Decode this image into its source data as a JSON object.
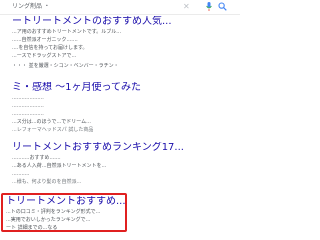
{
  "search": {
    "query": "リング剤品 ・"
  },
  "results": [
    {
      "title": "ートリートメントのおすすめ人気...",
      "snippets": [
        "...ア用のおすすめトリートメントです。ルブル...",
        "......自然派オーガニック.......",
        "....を自信を持ってお届けします。"
      ],
      "sitelinks": "...ースでドラッグストアで...",
      "meta": ""
    },
    {
      "title": "",
      "snippets": [
        "・・・ 並を厳選・シコン・ベンバー・ラチン・"
      ],
      "sitelinks": "",
      "meta": ""
    },
    {
      "title": "ミ・感想 ～1ヶ月使ってみた",
      "snippets": [
        "....................",
        "....................",
        "....................",
        "....................."
      ],
      "sitelinks": "...ス分は...のほうで...でドリーム...",
      "meta": "...レフォーマヘッドスパ 試した商品"
    },
    {
      "title": "リートメントおすすめランキング17...",
      "snippets": [
        "...........おすすめ.......",
        "...ある人入荷...自然派トリートメントを...",
        "...........",
        "..........."
      ],
      "sitelinks": "",
      "meta": "...様も、何より髪のを自然派..."
    },
    {
      "title": "トリートメントおすすめ...",
      "snippets": [
        "...トの口コミ・評判をランキング形式で...",
        "...実用でおいしかったランキングで...",
        "...........",
        "...........",
        "...........",
        "ート 詳細までの...なる"
      ],
      "sitelinks": "",
      "meta": ""
    }
  ],
  "accent": {
    "link": "#1a0dab",
    "highlight": "#e02020",
    "text": "#4d5156"
  }
}
